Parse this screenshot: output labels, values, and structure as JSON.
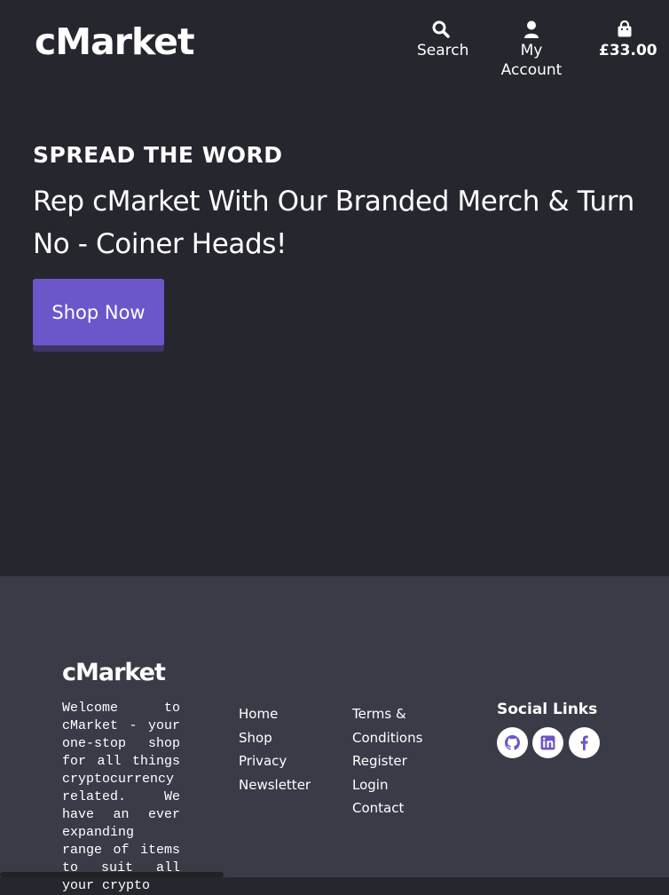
{
  "header": {
    "logo": "cMarket",
    "nav": {
      "search_label": "Search",
      "account_label": "My Account",
      "cart_total": "£33.00"
    },
    "icons": {
      "search": "search-icon",
      "account": "user-icon",
      "cart": "shopping-bag-icon"
    }
  },
  "hero": {
    "kicker": "SPREAD THE WORD",
    "title": "Rep cMarket With Our Branded Merch & Turn No - Coiner Heads!",
    "button_label": "Shop Now"
  },
  "footer": {
    "logo": "cMarket",
    "description": "Welcome to cMarket - your one-stop shop for all things cryptocurrency related. We have an ever expanding range of items to suit all your crypto",
    "links_col1": [
      "Home",
      "Shop",
      "Privacy",
      "Newsletter"
    ],
    "links_col2": [
      "Terms &",
      "Conditions",
      "Register",
      "Login",
      "Contact"
    ],
    "social_title": "Social Links",
    "social_icons": [
      "github-icon",
      "linkedin-icon",
      "facebook-icon"
    ]
  },
  "colors": {
    "page_bg": "#26272e",
    "footer_bg": "#393c47",
    "accent": "#6c56c9",
    "accent_shadow": "#3f3566",
    "text": "#ffffff"
  }
}
